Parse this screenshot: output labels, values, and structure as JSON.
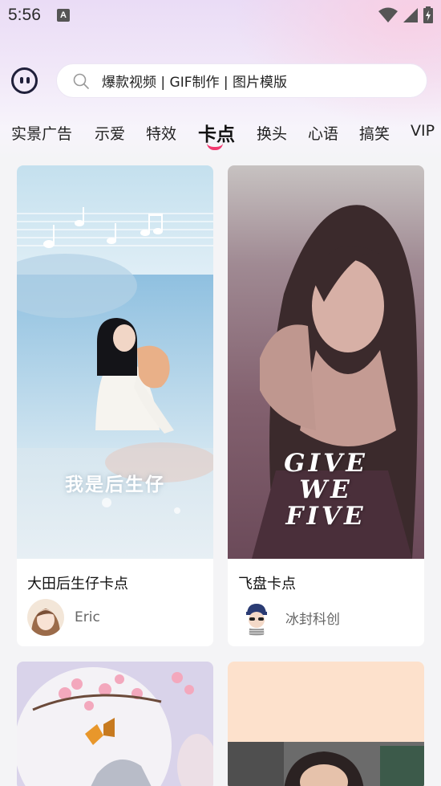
{
  "status_bar": {
    "time": "5:56",
    "notification_icon_letter": "A",
    "icons": [
      "wifi-icon",
      "signal-icon",
      "battery-icon"
    ]
  },
  "header": {
    "search_text": "爆款视频 | GIF制作 | 图片模版"
  },
  "tabs": [
    {
      "label": "实景广告",
      "active": false
    },
    {
      "label": "示爱",
      "active": false
    },
    {
      "label": "特效",
      "active": false
    },
    {
      "label": "卡点",
      "active": true
    },
    {
      "label": "换头",
      "active": false
    },
    {
      "label": "心语",
      "active": false
    },
    {
      "label": "搞笑",
      "active": false
    },
    {
      "label": "VIP",
      "active": false
    }
  ],
  "cards": [
    {
      "title": "大田后生仔卡点",
      "author": "Eric",
      "overlay_text": "我是后生仔"
    },
    {
      "title": "飞盘卡点",
      "author": "冰封科创",
      "overlay_text": [
        "GIVE",
        "WE",
        "FIVE"
      ]
    },
    {
      "title": "",
      "author": ""
    },
    {
      "title": "",
      "author": ""
    }
  ],
  "colors": {
    "accent": "#f2386f",
    "background": "#f4f4f6",
    "card": "#ffffff"
  }
}
